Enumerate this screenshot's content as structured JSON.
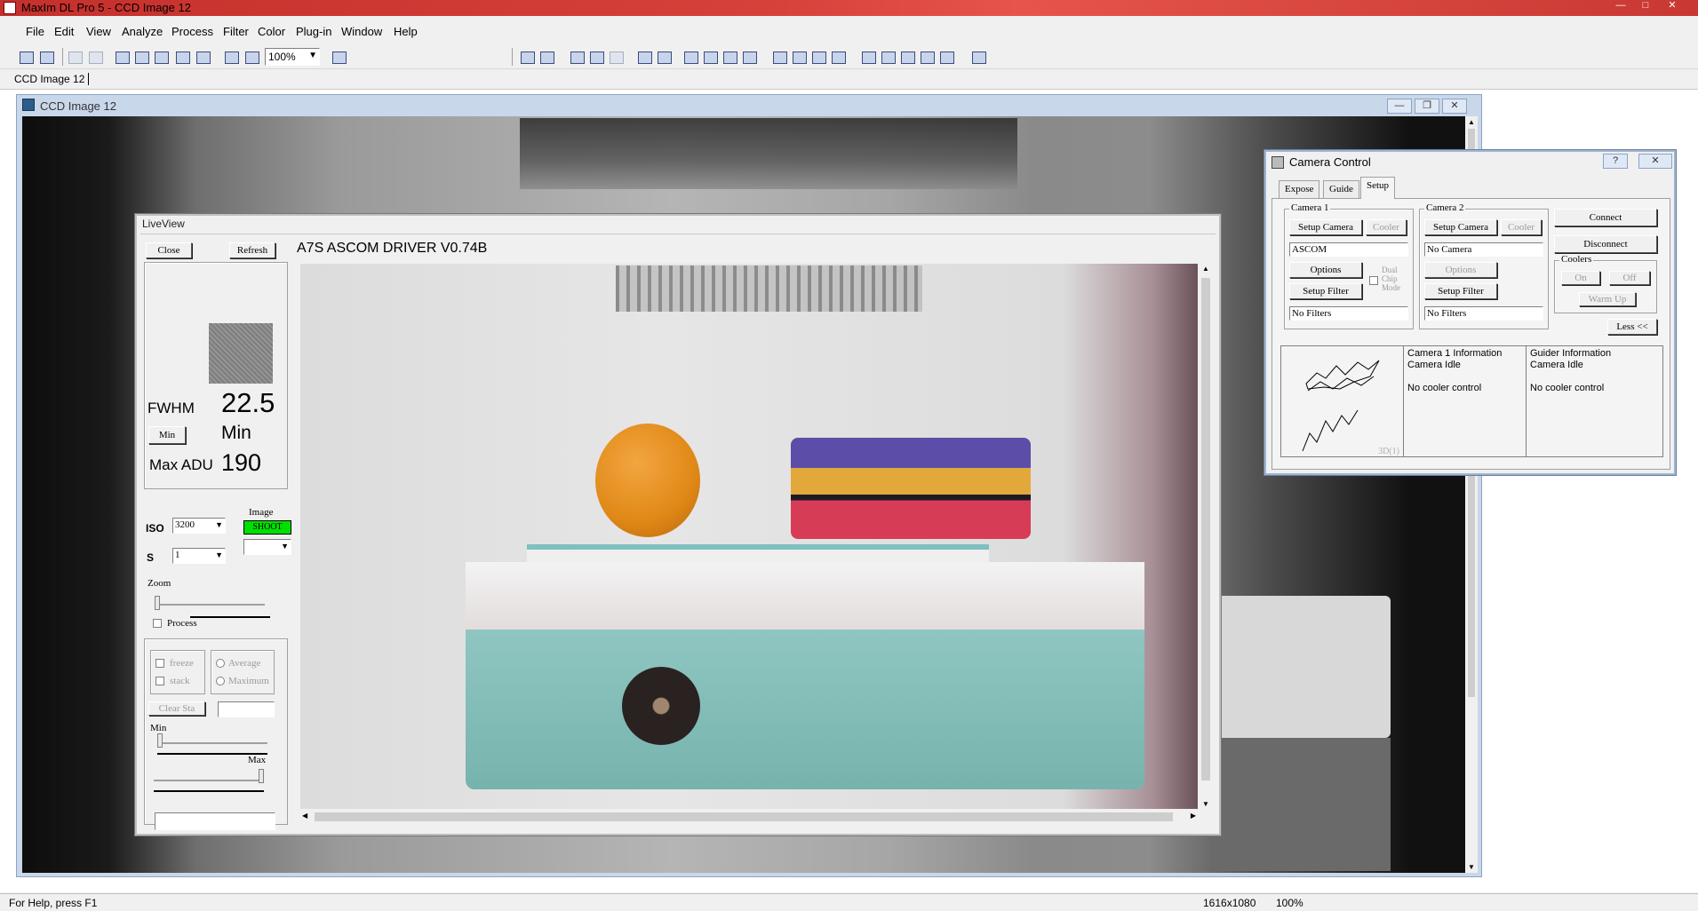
{
  "app": {
    "title": "MaxIm DL Pro 5 - CCD Image 12",
    "window_controls": [
      "—",
      "□",
      "✕"
    ]
  },
  "menu": [
    "File",
    "Edit",
    "View",
    "Analyze",
    "Process",
    "Filter",
    "Color",
    "Plug-in",
    "Window",
    "Help"
  ],
  "toolbar": {
    "zoom_value": "100%",
    "icons": [
      "open-icon",
      "save-icon",
      "undo-icon",
      "redo-icon",
      "image-icon",
      "palette-icon",
      "screen-stretch-icon",
      "hand-icon",
      "info-icon",
      "zoom-in-icon",
      "zoom-out-icon",
      "help-pointer-icon"
    ]
  },
  "doc_tabs": [
    "CCD Image 12"
  ],
  "ccd_window": {
    "title": "CCD Image 12"
  },
  "liveview": {
    "title": "LiveView",
    "close_label": "Close",
    "refresh_label": "Refresh",
    "driver_title": "A7S ASCOM DRIVER V0.74B",
    "fwhm_label": "FWHM",
    "fwhm_value": "22.5",
    "min_button": "Min",
    "min_label": "Min",
    "max_adu_label": "Max ADU",
    "max_adu_value": "190",
    "iso_label": "ISO",
    "iso_value": "3200",
    "s_label": "S",
    "s_value": "1",
    "image_label": "Image",
    "shoot_label": "SHOOT",
    "zoom_label": "Zoom",
    "process_label": "Process",
    "freeze_label": "freeze",
    "stack_label": "stack",
    "average_label": "Average",
    "maximum_label": "Maximum",
    "clear_stack_label": "Clear Sta",
    "min_slider_label": "Min",
    "max_slider_label": "Max",
    "shoot_color": "#00e000"
  },
  "camera_control": {
    "title": "Camera Control",
    "help_label": "?",
    "close_label": "✕",
    "tabs": [
      "Expose",
      "Guide",
      "Setup"
    ],
    "active_tab": "Setup",
    "camera1": {
      "group_label": "Camera 1",
      "setup_camera": "Setup Camera",
      "cooler": "Cooler",
      "camera_name": "ASCOM",
      "options": "Options",
      "dual_chip_label": "Dual Chip Mode",
      "setup_filter": "Setup Filter",
      "filter_name": "No Filters"
    },
    "camera2": {
      "group_label": "Camera 2",
      "setup_camera": "Setup Camera",
      "cooler": "Cooler",
      "camera_name": "No Camera",
      "options": "Options",
      "setup_filter": "Setup Filter",
      "filter_name": "No Filters"
    },
    "connect": "Connect",
    "disconnect": "Disconnect",
    "coolers_label": "Coolers",
    "cooler_on": "On",
    "cooler_off": "Off",
    "warm_up": "Warm Up",
    "less": "Less <<",
    "info": {
      "cam1_title": "Camera 1 Information",
      "cam1_status": "Camera Idle",
      "cam1_cooler": "No cooler control",
      "guider_title": "Guider Information",
      "guider_status": "Camera Idle",
      "guider_cooler": "No cooler control",
      "plot_label": "3D(1)"
    }
  },
  "status": {
    "help": "For Help, press F1",
    "dimensions": "1616x1080",
    "zoom": "100%"
  }
}
